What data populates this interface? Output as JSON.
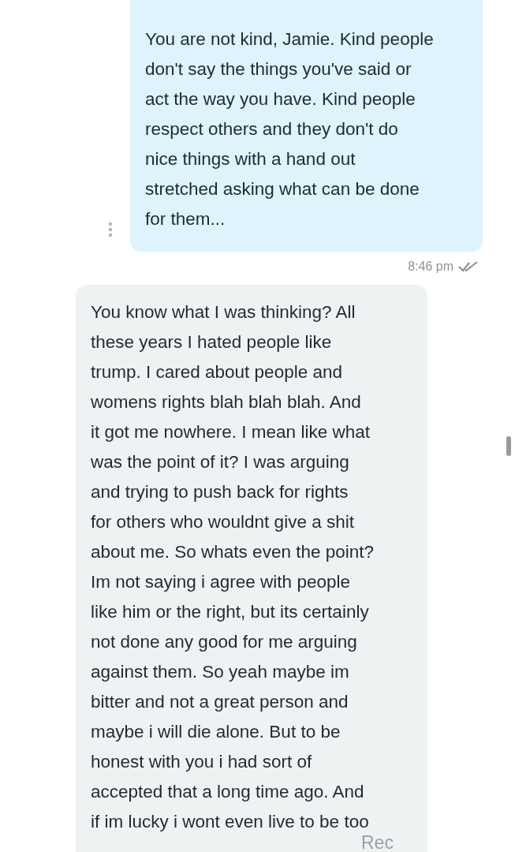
{
  "messages": [
    {
      "kind": "sent",
      "text": "You are not kind, Jamie. Kind people\ndon't say the things you've said or\nact the way you have. Kind people\nrespect others and they don't do\nnice things with a hand out\nstretched asking what can be done\nfor them...",
      "time": "8:46 pm",
      "read": true
    },
    {
      "kind": "received",
      "text": "You know what I was thinking? All\nthese years I hated people like\ntrump. I cared about people and\nwomens rights blah blah blah. And\nit got me nowhere. I mean like what\nwas the point of it? I was arguing\nand trying to push back for rights\nfor others who wouldnt give a shit\nabout me. So whats even the point?\nIm not saying i agree with people\nlike him or the right, but its certainly\nnot done any good for me arguing\nagainst them. So yeah maybe im\nbitter and not a great person and\nmaybe i will die alone. But to be\nhonest with you i had sort of\naccepted that a long time ago. And\nif im lucky i wont even live to be too"
    }
  ],
  "footer_label": "Rec"
}
